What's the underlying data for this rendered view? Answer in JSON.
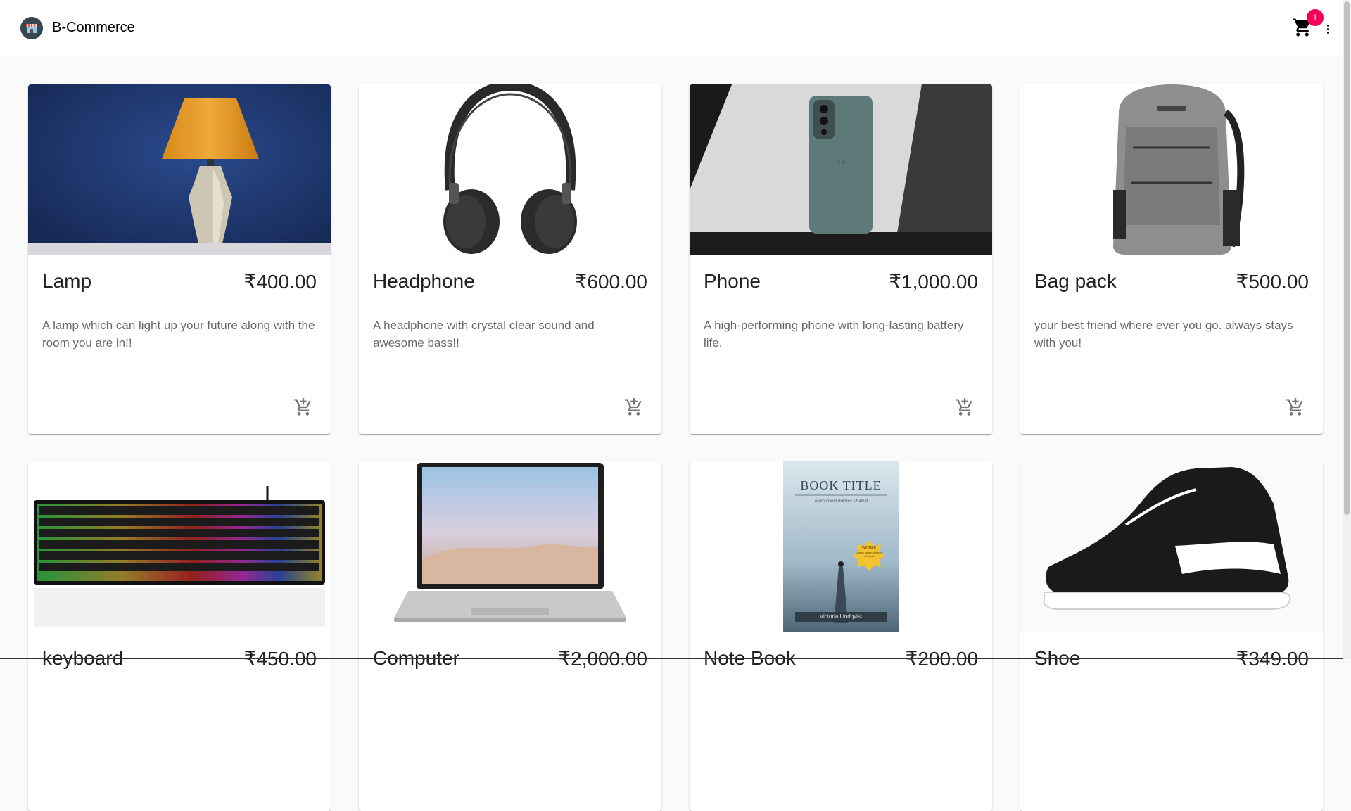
{
  "header": {
    "brand": "B-Commerce",
    "cart_count": "1",
    "logo_icon": "store-icon",
    "cart_icon": "shopping-cart-icon",
    "menu_icon": "more-vertical-icon"
  },
  "colors": {
    "accent_badge": "#f50057",
    "logo_bg": "#37474f",
    "page_bg": "#fafafa"
  },
  "products": [
    {
      "name": "Lamp",
      "price": "₹400.00",
      "description": "A lamp which can light up your future along with the room you are in!!",
      "image": "lamp-image"
    },
    {
      "name": "Headphone",
      "price": "₹600.00",
      "description": "A headphone with crystal clear sound and awesome bass!!",
      "image": "headphone-image"
    },
    {
      "name": "Phone",
      "price": "₹1,000.00",
      "description": "A high-performing phone with long-lasting battery life.",
      "image": "phone-image"
    },
    {
      "name": "Bag pack",
      "price": "₹500.00",
      "description": "your best friend where ever you go. always stays with you!",
      "image": "backpack-image"
    },
    {
      "name": "keyboard",
      "price": "₹450.00",
      "description": "",
      "image": "keyboard-image"
    },
    {
      "name": "Computer",
      "price": "₹2,000.00",
      "description": "",
      "image": "laptop-image"
    },
    {
      "name": "Note Book",
      "price": "₹200.00",
      "description": "",
      "image": "book-image"
    },
    {
      "name": "Shoe",
      "price": "₹349.00",
      "description": "",
      "image": "shoe-image"
    }
  ],
  "book_cover": {
    "title": "BOOK TITLE",
    "subtitle": "Lorem ipsum dolores sit amet.",
    "author": "Victoria Lindqvist",
    "badge_title": "WINNER",
    "badge_text": "Lorem ipsum dolores sit amet"
  }
}
